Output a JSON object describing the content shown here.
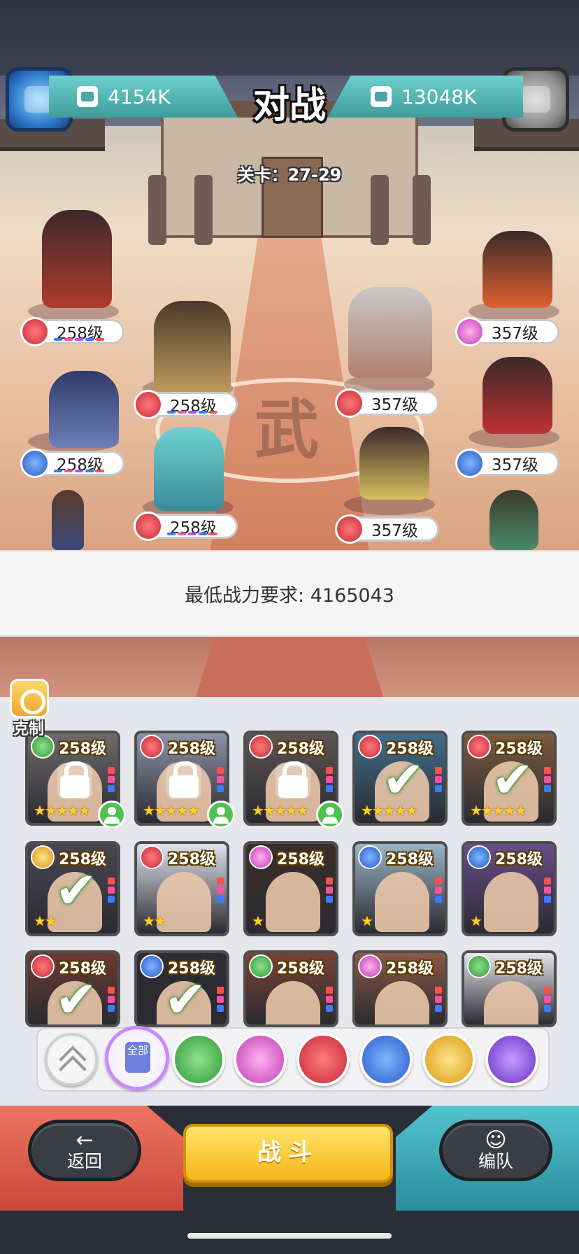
{
  "battle": {
    "title": "对战",
    "stage": "关卡：27-29",
    "left_power": "4154K",
    "right_power": "13048K",
    "left_heroes": [
      {
        "level": "258级",
        "faction": "red"
      },
      {
        "level": "258级",
        "faction": "red"
      },
      {
        "level": "258级",
        "faction": "blue"
      },
      {
        "level": "258级",
        "faction": "red"
      }
    ],
    "right_heroes": [
      {
        "level": "357级",
        "faction": "pink"
      },
      {
        "level": "357级",
        "faction": "red"
      },
      {
        "level": "357级",
        "faction": "blue"
      },
      {
        "level": "357级",
        "faction": "red"
      }
    ]
  },
  "requirement": "最低战力要求: 4165043",
  "counter_label": "克制",
  "roster": [
    {
      "level": "258级",
      "faction": "green",
      "stars": "★★★★★",
      "state": "locked",
      "tint": "#6e6a6a"
    },
    {
      "level": "258级",
      "faction": "red",
      "stars": "★★★★★",
      "state": "locked",
      "tint": "#8d93a6"
    },
    {
      "level": "258级",
      "faction": "red",
      "stars": "★★★★★",
      "state": "locked",
      "tint": "#5c5550"
    },
    {
      "level": "258级",
      "faction": "red",
      "stars": "★★★★★",
      "state": "selected",
      "tint": "#3f6e8d"
    },
    {
      "level": "258级",
      "faction": "red",
      "stars": "★★★★★",
      "state": "selected",
      "tint": "#7a5a3f"
    },
    {
      "level": "258级",
      "faction": "gold",
      "stars": "★★",
      "state": "selected",
      "tint": "#4a4650"
    },
    {
      "level": "258级",
      "faction": "red",
      "stars": "★★",
      "state": "normal",
      "tint": "#dfe3ee"
    },
    {
      "level": "258级",
      "faction": "pink",
      "stars": "★",
      "state": "normal",
      "tint": "#3a2f2a"
    },
    {
      "level": "258级",
      "faction": "blue",
      "stars": "★",
      "state": "normal",
      "tint": "#9ab3c4"
    },
    {
      "level": "258级",
      "faction": "blue",
      "stars": "★",
      "state": "normal",
      "tint": "#6a4d8a"
    },
    {
      "level": "258级",
      "faction": "red",
      "stars": "",
      "state": "selected",
      "tint": "#6b3a32"
    },
    {
      "level": "258级",
      "faction": "blue",
      "stars": "",
      "state": "selected",
      "tint": "#2e2d35"
    },
    {
      "level": "258级",
      "faction": "green",
      "stars": "",
      "state": "normal",
      "tint": "#7a4236"
    },
    {
      "level": "258级",
      "faction": "pink",
      "stars": "",
      "state": "normal",
      "tint": "#8a5a45"
    },
    {
      "level": "258级",
      "faction": "green",
      "stars": "",
      "state": "normal",
      "tint": "#e4e4ea"
    }
  ],
  "filters": {
    "all_label": "全部",
    "factions": [
      "green",
      "pink",
      "red",
      "blue",
      "gold",
      "purple"
    ]
  },
  "controls": {
    "back_label": "返回",
    "fight_label": "战斗",
    "team_label": "编队"
  },
  "colors": {
    "power_bar": "#4fb4b2",
    "fight_button": "#f7c631",
    "back_panel": "#e0604f",
    "team_panel": "#41aab8"
  }
}
